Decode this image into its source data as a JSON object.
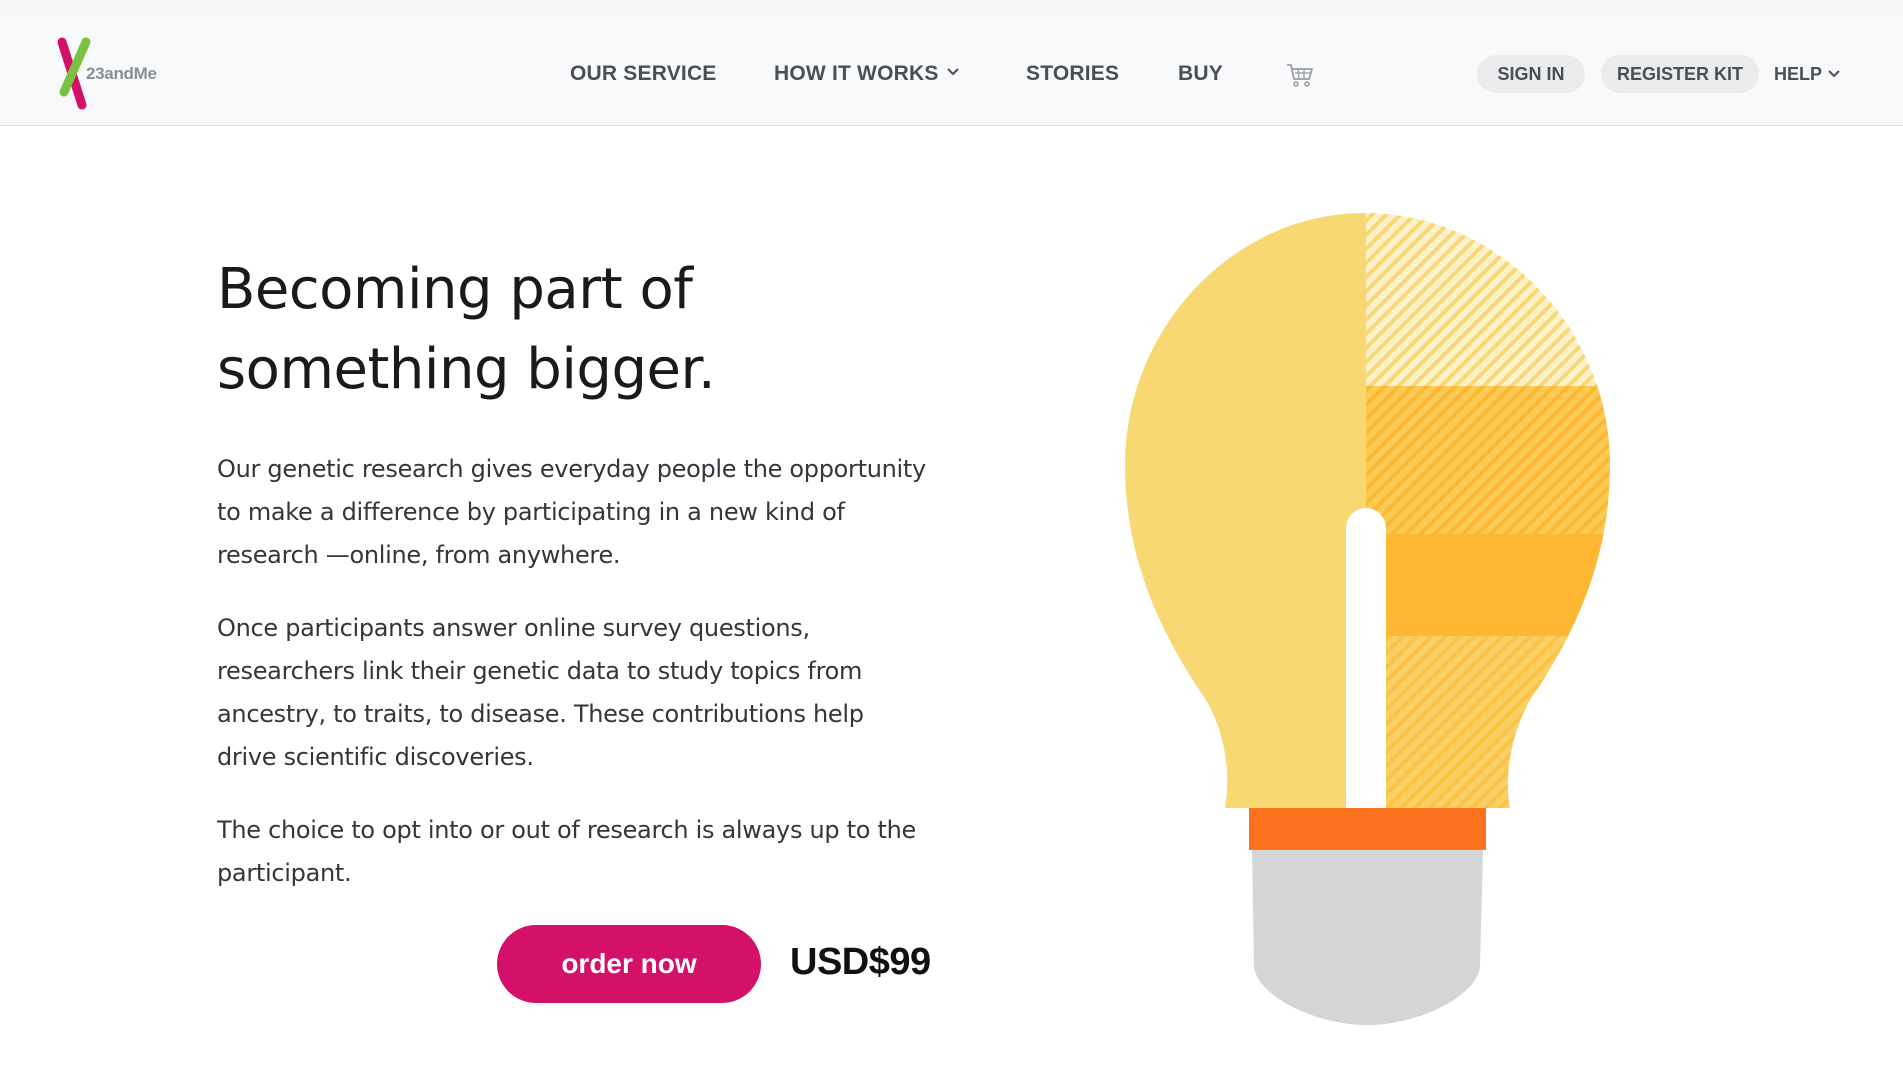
{
  "brand": {
    "logo_text": "23andMe",
    "colors": {
      "green": "#7ac143",
      "pink": "#d31168"
    }
  },
  "nav": {
    "links": [
      {
        "label": "OUR SERVICE"
      },
      {
        "label": "HOW IT WORKS",
        "icon": "chevron-down-icon"
      },
      {
        "label": "STORIES"
      },
      {
        "label": "BUY"
      }
    ],
    "cart_icon": "cart-icon",
    "sign_in": "SIGN IN",
    "register_kit": "REGISTER KIT",
    "help": "HELP"
  },
  "hero": {
    "headline_line1": "Becoming part of",
    "headline_line2": "something bigger.",
    "paragraphs": [
      "Our genetic research gives everyday people the opportunity to make a difference by participating in a new kind of research —online, from anywhere.",
      "Once participants answer online survey questions, researchers link their genetic data to study topics from ancestry, to traits, to disease. These contributions help drive scientific discoveries.",
      "The choice to opt into or out of research is always up to the participant."
    ],
    "cta_label": "order now",
    "price": "USD$99",
    "cta_color": "#d31168"
  },
  "illustration": {
    "icon": "lightbulb-icon",
    "colors": {
      "light_yellow": "#f8d872",
      "amber": "#fdb733",
      "orange": "#fc7320",
      "base_gray": "#d4d5d5"
    }
  }
}
